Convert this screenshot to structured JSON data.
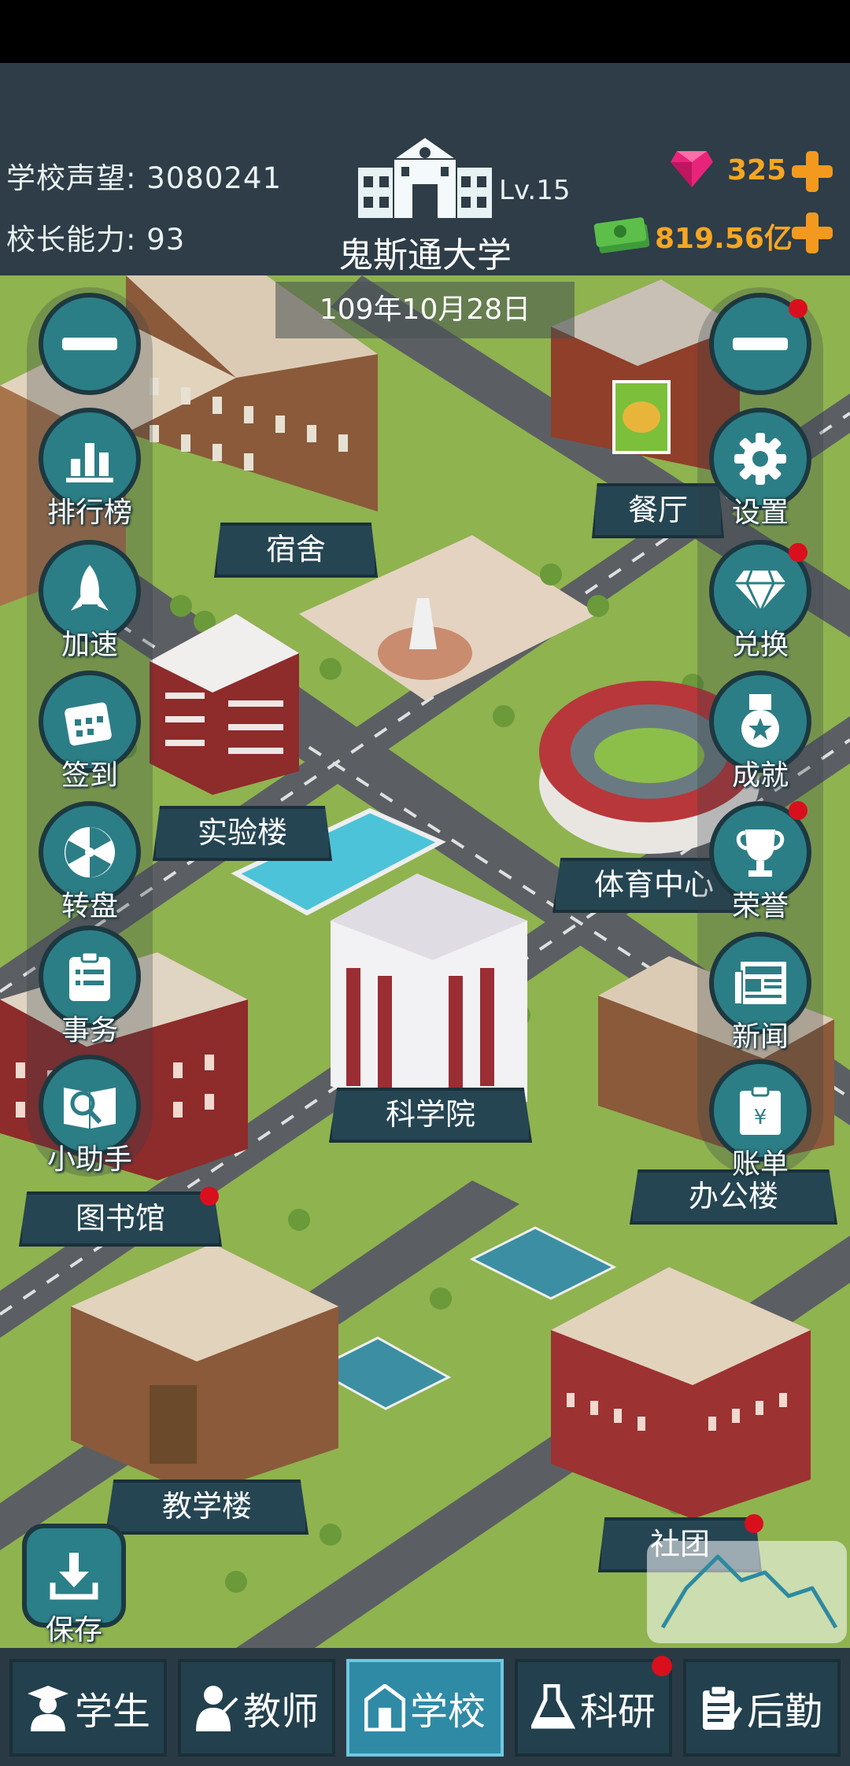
{
  "header": {
    "reputation_label": "学校声望:",
    "reputation_value": "3080241",
    "ability_label": "校长能力:",
    "ability_value": "93",
    "level": "Lv.15",
    "school_name": "鬼斯通大学",
    "gems": "325",
    "money": "819.56亿",
    "date": "109年10月28日"
  },
  "left_menu": [
    {
      "label": "",
      "icon": "minus-icon"
    },
    {
      "label": "排行榜",
      "icon": "bar-chart-icon"
    },
    {
      "label": "加速",
      "icon": "rocket-icon"
    },
    {
      "label": "签到",
      "icon": "calendar-icon"
    },
    {
      "label": "转盘",
      "icon": "wheel-icon"
    },
    {
      "label": "事务",
      "icon": "clipboard-icon"
    },
    {
      "label": "小助手",
      "icon": "book-magnifier-icon"
    }
  ],
  "right_menu": [
    {
      "label": "",
      "icon": "minus-icon",
      "badge": true
    },
    {
      "label": "设置",
      "icon": "gear-icon",
      "badge": false
    },
    {
      "label": "兑换",
      "icon": "diamond-icon",
      "badge": true
    },
    {
      "label": "成就",
      "icon": "medal-icon",
      "badge": false
    },
    {
      "label": "荣誉",
      "icon": "trophy-icon",
      "badge": true
    },
    {
      "label": "新闻",
      "icon": "news-icon",
      "badge": false
    },
    {
      "label": "账单",
      "icon": "bill-icon",
      "badge": false
    }
  ],
  "buildings": {
    "dorm": "宿舍",
    "restaurant": "餐厅",
    "lab": "实验楼",
    "stadium": "体育中心",
    "science": "科学院",
    "library": "图书馆",
    "office": "办公楼",
    "teaching": "教学楼",
    "club": "社团"
  },
  "save_label": "保存",
  "nav_tabs": [
    {
      "label": "学生",
      "icon": "student-icon"
    },
    {
      "label": "教师",
      "icon": "teacher-icon"
    },
    {
      "label": "学校",
      "icon": "school-icon"
    },
    {
      "label": "科研",
      "icon": "flask-icon"
    },
    {
      "label": "后勤",
      "icon": "logistics-icon"
    }
  ],
  "colors": {
    "topbar": "#2e3d47",
    "grass": "#8fb34f",
    "road": "#5b5f63",
    "button": "#2c7e86",
    "badge": "#d90f1e",
    "currency": "#f6a623"
  }
}
